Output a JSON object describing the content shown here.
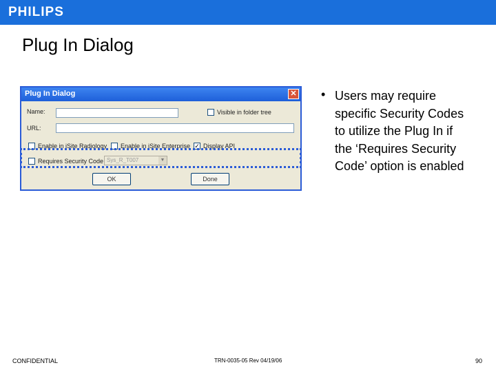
{
  "header": {
    "brand": "PHILIPS",
    "color": "#1a6fdb"
  },
  "slide": {
    "title": "Plug In Dialog"
  },
  "dialog": {
    "title": "Plug In Dialog",
    "close_glyph": "✕",
    "name_label": "Name:",
    "url_label": "URL:",
    "visible_in_folder_tree": {
      "label": "Visible in folder tree",
      "checked": false
    },
    "enable_eflm_radiology": {
      "label": "Enable in iSite Radiology",
      "checked": false
    },
    "enable_isite_enterprise": {
      "label": "Enable in iSite Enterprise",
      "checked": false
    },
    "display_api": {
      "label": "Display API",
      "checked": true
    },
    "requires_security_code": {
      "label": "Requires Security Code",
      "checked": false
    },
    "security_code_value": "Sys_R_T007",
    "ok_label": "OK",
    "done_label": "Done"
  },
  "bullet": {
    "glyph": "•",
    "text": "Users may require specific Security Codes to utilize the Plug In if the ‘Requires Security Code’ option is enabled"
  },
  "footer": {
    "left": "CONFIDENTIAL",
    "center": "TRN-0035-05 Rev 04/19/06",
    "page": "90"
  }
}
